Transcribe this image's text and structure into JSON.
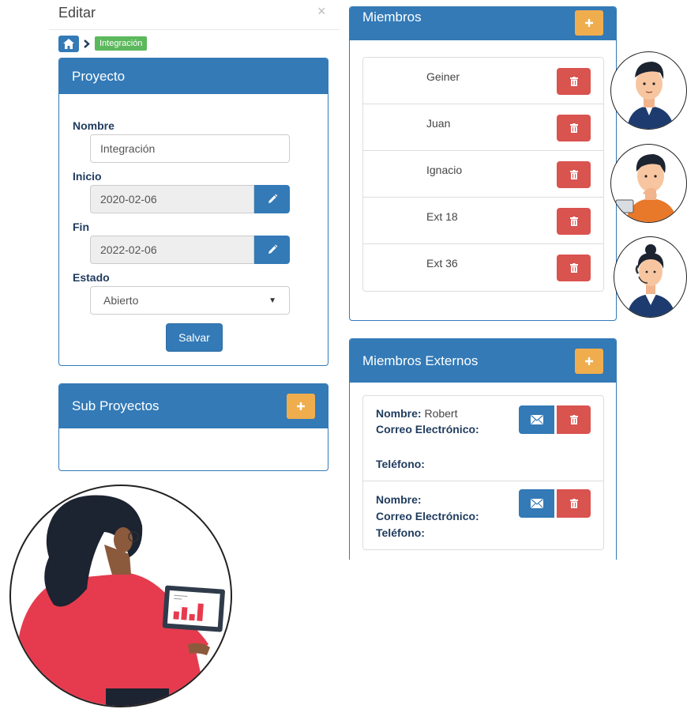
{
  "modal": {
    "title": "Editar",
    "close": "×"
  },
  "breadcrumb": {
    "current": "Integración"
  },
  "proyecto": {
    "title": "Proyecto",
    "nombre_label": "Nombre",
    "nombre_value": "Integración",
    "inicio_label": "Inicio",
    "inicio_value": "2020-02-06",
    "fin_label": "Fin",
    "fin_value": "2022-02-06",
    "estado_label": "Estado",
    "estado_value": "Abierto",
    "save_label": "Salvar"
  },
  "sub_proyectos": {
    "title": "Sub Proyectos"
  },
  "miembros": {
    "title": "Miembros",
    "items": [
      {
        "name": "Geiner"
      },
      {
        "name": "Juan"
      },
      {
        "name": "Ignacio"
      },
      {
        "name": "Ext 18"
      },
      {
        "name": "Ext 36"
      }
    ]
  },
  "miembros_externos": {
    "title": "Miembros Externos",
    "labels": {
      "nombre": "Nombre:",
      "correo": "Correo Electrónico:",
      "telefono": "Teléfono:"
    },
    "items": [
      {
        "nombre": "Robert",
        "correo": "",
        "telefono": ""
      },
      {
        "nombre": "",
        "correo": "",
        "telefono": ""
      }
    ]
  },
  "colors": {
    "primary": "#337ab7",
    "warning": "#f0ad4e",
    "danger": "#d9534f",
    "success": "#5cb85c"
  },
  "icons": {
    "home": "home-icon",
    "chevron": "chevron-right-icon",
    "edit": "pencil-icon",
    "add": "plus-icon",
    "delete": "trash-icon",
    "email": "envelope-icon"
  }
}
